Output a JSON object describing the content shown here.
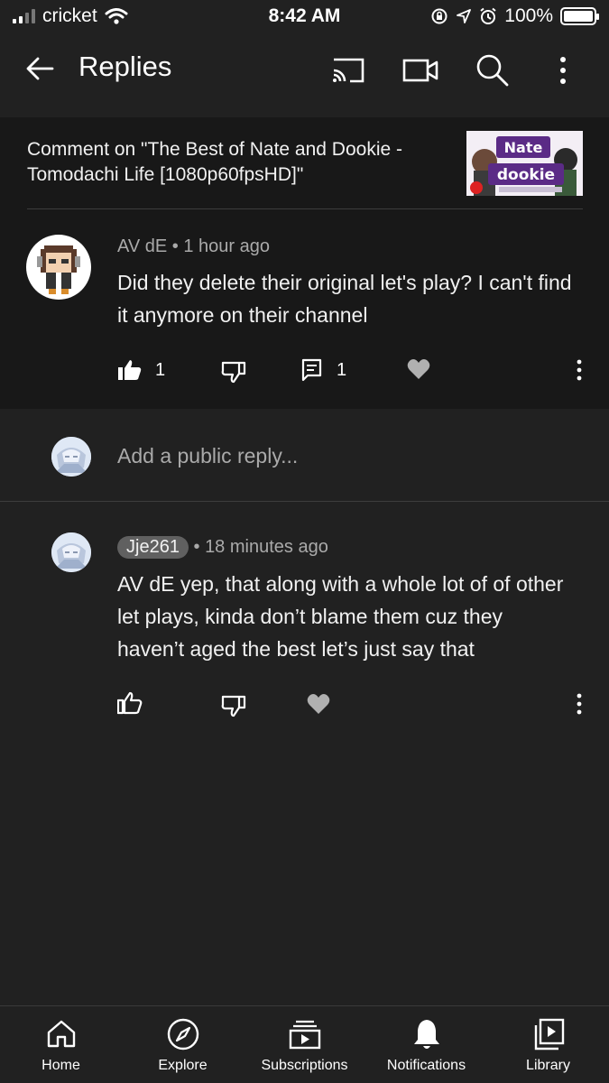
{
  "status_bar": {
    "carrier": "cricket",
    "time": "8:42 AM",
    "battery": "100%"
  },
  "app_bar": {
    "title": "Replies",
    "icons": [
      "back-arrow-icon",
      "cast-icon",
      "video-camera-icon",
      "search-icon",
      "more-vert-icon"
    ]
  },
  "video": {
    "comment_on": "Comment on \"The Best of Nate and Dookie - Tomodachi Life [1080p60fpsHD]\"",
    "thumbnail_text_top": "Nate",
    "thumbnail_text_bottom": "dookie"
  },
  "parent_comment": {
    "author": "AV dE",
    "time": "1 hour ago",
    "text": "Did they delete their original let's play? I can't find it anymore on their channel",
    "likes": "1",
    "replies": "1"
  },
  "reply_input": {
    "placeholder": "Add a public reply..."
  },
  "reply": {
    "author": "Jje261",
    "time": "18 minutes ago",
    "text": "AV dE yep, that along with a whole lot of of other let plays, kinda don’t blame them cuz they haven’t aged the best let’s just say that"
  },
  "bottom_nav": [
    {
      "label": "Home",
      "icon": "home-icon"
    },
    {
      "label": "Explore",
      "icon": "compass-icon"
    },
    {
      "label": "Subscriptions",
      "icon": "subscriptions-icon"
    },
    {
      "label": "Notifications",
      "icon": "bell-icon"
    },
    {
      "label": "Library",
      "icon": "library-icon"
    }
  ],
  "colors": {
    "background": "#212121",
    "card": "#181818",
    "secondary_text": "#aaaaaa",
    "heart": "#b0b0b0"
  }
}
